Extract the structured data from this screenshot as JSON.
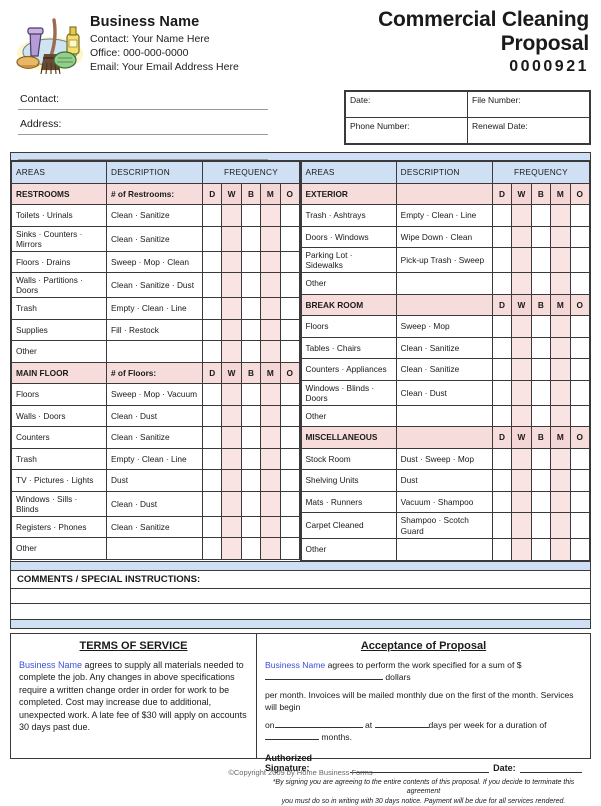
{
  "header": {
    "logo_icon": "cleaning-supplies-icon",
    "business_name": "Business Name",
    "contact_line": "Contact:  Your Name Here",
    "office_line": "Office:  000-000-0000",
    "email_line": "Email:  Your Email Address Here",
    "doc_title": "Commercial Cleaning Proposal",
    "doc_number": "0000921"
  },
  "fill_fields": [
    {
      "label": "Contact:",
      "value": ""
    },
    {
      "label": "Address:",
      "value": ""
    },
    {
      "label": "",
      "value": ""
    }
  ],
  "date_box": [
    {
      "label": "Date:",
      "value": ""
    },
    {
      "label": "File Number:",
      "value": ""
    },
    {
      "label": "Phone Number:",
      "value": ""
    },
    {
      "label": "Renewal Date:",
      "value": ""
    }
  ],
  "table_headers": {
    "areas": "AREAS",
    "description": "DESCRIPTION",
    "frequency": "FREQUENCY"
  },
  "frequency_codes": [
    "D",
    "W",
    "B",
    "M",
    "O"
  ],
  "frequency_shaded": [
    false,
    true,
    false,
    true,
    false
  ],
  "left_sections": [
    {
      "name": "RESTROOMS",
      "desc": "# of Restrooms:",
      "show_codes": true,
      "rows": [
        {
          "area": "Toilets · Urinals",
          "desc": "Clean · Sanitize"
        },
        {
          "area": "Sinks · Counters · Mirrors",
          "desc": "Clean · Sanitize"
        },
        {
          "area": "Floors · Drains",
          "desc": "Sweep · Mop · Clean"
        },
        {
          "area": "Walls · Partitions · Doors",
          "desc": "Clean · Sanitize · Dust"
        },
        {
          "area": "Trash",
          "desc": "Empty · Clean · Line"
        },
        {
          "area": "Supplies",
          "desc": "Fill · Restock"
        },
        {
          "area": "Other",
          "desc": ""
        }
      ]
    },
    {
      "name": "MAIN FLOOR",
      "desc": "# of Floors:",
      "show_codes": true,
      "rows": [
        {
          "area": "Floors",
          "desc": "Sweep · Mop · Vacuum"
        },
        {
          "area": "Walls · Doors",
          "desc": "Clean · Dust"
        },
        {
          "area": "Counters",
          "desc": "Clean · Sanitize"
        },
        {
          "area": "Trash",
          "desc": "Empty · Clean · Line"
        },
        {
          "area": "TV · Pictures · Lights",
          "desc": "Dust"
        },
        {
          "area": "Windows · Sills · Blinds",
          "desc": "Clean · Dust"
        },
        {
          "area": "Registers · Phones",
          "desc": "Clean · Sanitize"
        },
        {
          "area": "Other",
          "desc": ""
        }
      ]
    }
  ],
  "right_sections": [
    {
      "name": "EXTERIOR",
      "desc": "",
      "show_codes": true,
      "rows": [
        {
          "area": "Trash · Ashtrays",
          "desc": "Empty · Clean · Line"
        },
        {
          "area": "Doors · Windows",
          "desc": "Wipe Down · Clean"
        },
        {
          "area": "Parking Lot · Sidewalks",
          "desc": "Pick-up Trash · Sweep"
        },
        {
          "area": "Other",
          "desc": ""
        }
      ]
    },
    {
      "name": "BREAK ROOM",
      "desc": "",
      "show_codes": true,
      "rows": [
        {
          "area": "Floors",
          "desc": "Sweep · Mop"
        },
        {
          "area": "Tables · Chairs",
          "desc": "Clean · Sanitize"
        },
        {
          "area": "Counters · Appliances",
          "desc": "Clean · Sanitize"
        },
        {
          "area": "Windows · Blinds · Doors",
          "desc": "Clean · Dust"
        },
        {
          "area": "Other",
          "desc": ""
        }
      ]
    },
    {
      "name": "MISCELLANEOUS",
      "desc": "",
      "show_codes": true,
      "rows": [
        {
          "area": "Stock Room",
          "desc": "Dust · Sweep · Mop"
        },
        {
          "area": "Shelving Units",
          "desc": "Dust"
        },
        {
          "area": "Mats · Runners",
          "desc": "Vacuum · Shampoo"
        },
        {
          "area": "Carpet Cleaned",
          "desc": "Shampoo · Scotch Guard",
          "tall": true
        },
        {
          "area": "Other",
          "desc": ""
        }
      ]
    }
  ],
  "comments": {
    "title": "COMMENTS / SPECIAL INSTRUCTIONS:",
    "blank_lines": 3
  },
  "terms_of_service": {
    "title": "TERMS OF SERVICE",
    "business_name": "Business Name",
    "body": " agrees to supply all materials needed to complete the job.  Any changes in above specifications require a written change order in order for work to be completed.  Cost may increase due to additional, unexpected work.  A late fee of $30 will apply on accounts 30 days past due."
  },
  "acceptance": {
    "title": "Acceptance of Proposal",
    "business_name": "Business Name",
    "p1_a": " agrees to perform the work specified for a sum of $",
    "p1_b": "dollars",
    "p2": "per month.  Invoices will be mailed monthly due on the first of the month.  Services will begin",
    "p3_a": "on",
    "p3_b": "at",
    "p3_c": "days per week for a duration of",
    "p3_d": "months.",
    "signature_label": "Authorized Signature:",
    "date_label": "Date:",
    "fineprint_1": "*By signing you are agreeing to the entire contents of this proposal.  If you decide to terminate this agreement",
    "fineprint_2": "you must do so in writing with 30 days notice.  Payment will be due for all services rendered."
  },
  "footer": {
    "copyright": "©Copyright 2009 by Home Business Forms"
  },
  "colors": {
    "header_blue": "#cfe0f5",
    "section_pink": "#f7dcdc",
    "shaded_pink": "#fae3e3",
    "link_blue": "#3b4fd8",
    "border": "#3a3a3a"
  }
}
